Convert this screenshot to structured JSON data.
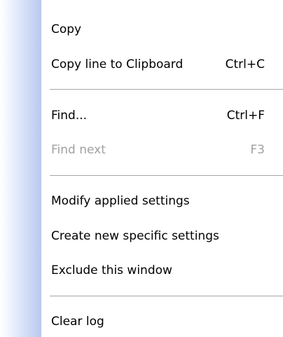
{
  "menu": {
    "items": [
      {
        "label": "Copy",
        "shortcut": ""
      },
      {
        "label": "Copy line to Clipboard",
        "shortcut": "Ctrl+C"
      },
      {
        "label": "Find...",
        "shortcut": "Ctrl+F"
      },
      {
        "label": "Find next",
        "shortcut": "F3",
        "disabled": true
      },
      {
        "label": "Modify applied settings",
        "shortcut": ""
      },
      {
        "label": "Create new specific settings",
        "shortcut": ""
      },
      {
        "label": "Exclude this window",
        "shortcut": ""
      },
      {
        "label": "Clear log",
        "shortcut": ""
      }
    ]
  }
}
